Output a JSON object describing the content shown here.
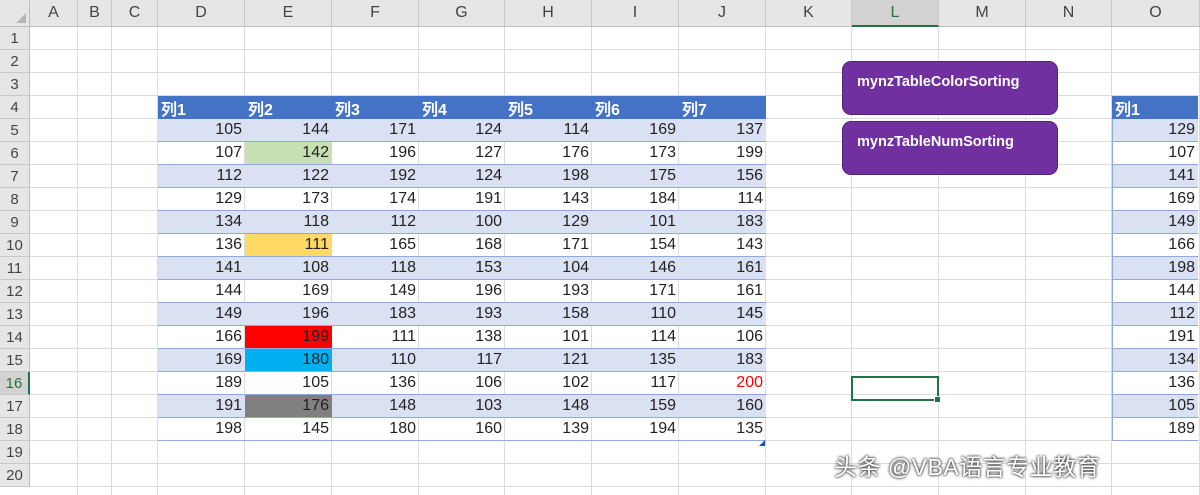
{
  "columns": [
    "A",
    "B",
    "C",
    "D",
    "E",
    "F",
    "G",
    "H",
    "I",
    "J",
    "K",
    "L",
    "M",
    "N",
    "O"
  ],
  "selected_column": "L",
  "rows": [
    "1",
    "2",
    "3",
    "4",
    "5",
    "6",
    "7",
    "8",
    "9",
    "10",
    "11",
    "12",
    "13",
    "14",
    "15",
    "16",
    "17",
    "18",
    "19",
    "20"
  ],
  "selected_row": "16",
  "table": {
    "headers": [
      "列1",
      "列2",
      "列3",
      "列4",
      "列5",
      "列6",
      "列7"
    ],
    "rows": [
      [
        "105",
        "144",
        "171",
        "124",
        "114",
        "169",
        "137"
      ],
      [
        "107",
        "142",
        "196",
        "127",
        "176",
        "173",
        "199"
      ],
      [
        "112",
        "122",
        "192",
        "124",
        "198",
        "175",
        "156"
      ],
      [
        "129",
        "173",
        "174",
        "191",
        "143",
        "184",
        "114"
      ],
      [
        "134",
        "118",
        "112",
        "100",
        "129",
        "101",
        "183"
      ],
      [
        "136",
        "111",
        "165",
        "168",
        "171",
        "154",
        "143"
      ],
      [
        "141",
        "108",
        "118",
        "153",
        "104",
        "146",
        "161"
      ],
      [
        "144",
        "169",
        "149",
        "196",
        "193",
        "171",
        "161"
      ],
      [
        "149",
        "196",
        "183",
        "193",
        "158",
        "110",
        "145"
      ],
      [
        "166",
        "199",
        "111",
        "138",
        "101",
        "114",
        "106"
      ],
      [
        "169",
        "180",
        "110",
        "117",
        "121",
        "135",
        "183"
      ],
      [
        "189",
        "105",
        "136",
        "106",
        "102",
        "117",
        "200"
      ],
      [
        "191",
        "176",
        "148",
        "103",
        "148",
        "159",
        "160"
      ],
      [
        "198",
        "145",
        "180",
        "160",
        "139",
        "194",
        "135"
      ]
    ],
    "cell_fills": [
      {
        "row": 1,
        "col": 1,
        "color": "#c6e0b4"
      },
      {
        "row": 5,
        "col": 1,
        "color": "#ffd966"
      },
      {
        "row": 9,
        "col": 1,
        "color": "#ff0000"
      },
      {
        "row": 10,
        "col": 1,
        "color": "#00b0f0"
      },
      {
        "row": 12,
        "col": 1,
        "color": "#808080"
      }
    ],
    "font_colors": [
      {
        "row": 11,
        "col": 6,
        "color": "#ff0000"
      }
    ]
  },
  "buttons": {
    "color_sort": "mynzTableColorSorting",
    "num_sort": "mynzTableNumSorting"
  },
  "side_table": {
    "header": "列1",
    "values": [
      "129",
      "107",
      "141",
      "169",
      "149",
      "166",
      "198",
      "144",
      "112",
      "191",
      "134",
      "136",
      "105",
      "189"
    ]
  },
  "watermark": "头条 @VBA语言专业教育",
  "colors": {
    "header_blue": "#4472c4",
    "band_blue": "#d9e1f2",
    "button_purple": "#7030a0",
    "excel_green": "#217346"
  }
}
